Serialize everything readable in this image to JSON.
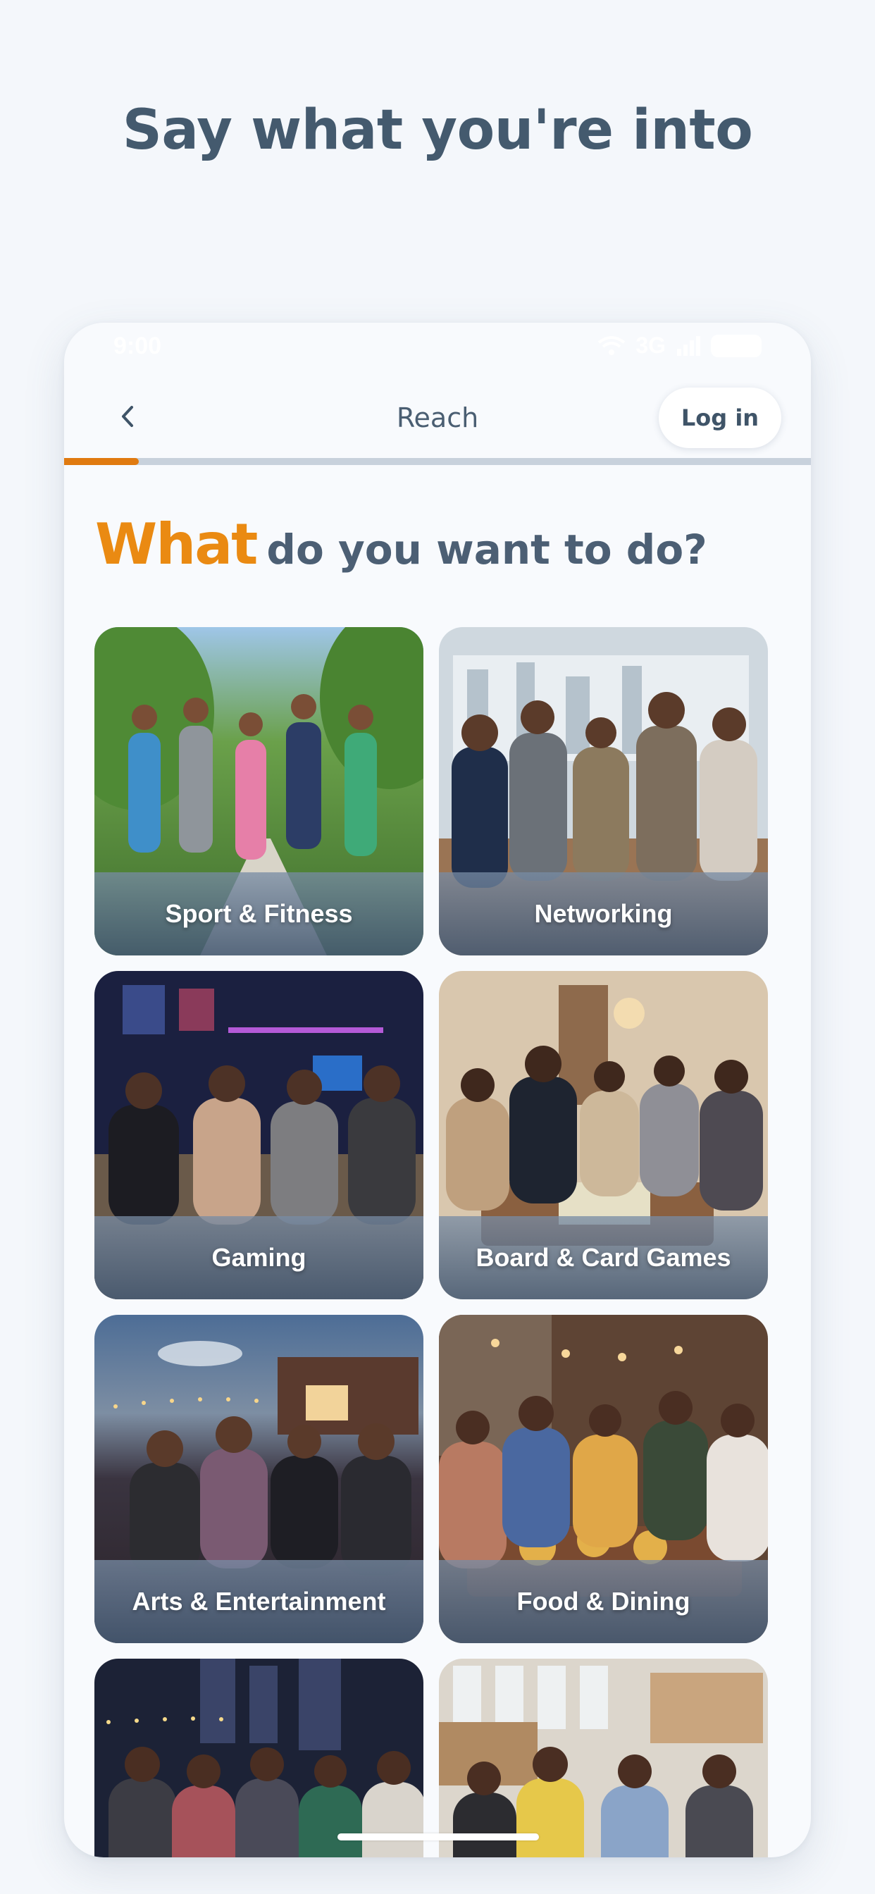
{
  "headline": "Say what you're into",
  "status_bar": {
    "time": "9:00",
    "network": "3G"
  },
  "nav": {
    "title": "Reach",
    "login_label": "Log in"
  },
  "progress": {
    "fraction": 0.1
  },
  "question": {
    "accent": "What",
    "rest": "do you want to do?"
  },
  "tiles": [
    {
      "label": "Sport & Fitness"
    },
    {
      "label": "Networking"
    },
    {
      "label": "Gaming"
    },
    {
      "label": "Board & Card Games"
    },
    {
      "label": "Arts & Entertainment"
    },
    {
      "label": "Food & Dining"
    },
    {
      "label": ""
    },
    {
      "label": ""
    }
  ],
  "colors": {
    "accent": "#e07a10",
    "text": "#445a6e"
  }
}
